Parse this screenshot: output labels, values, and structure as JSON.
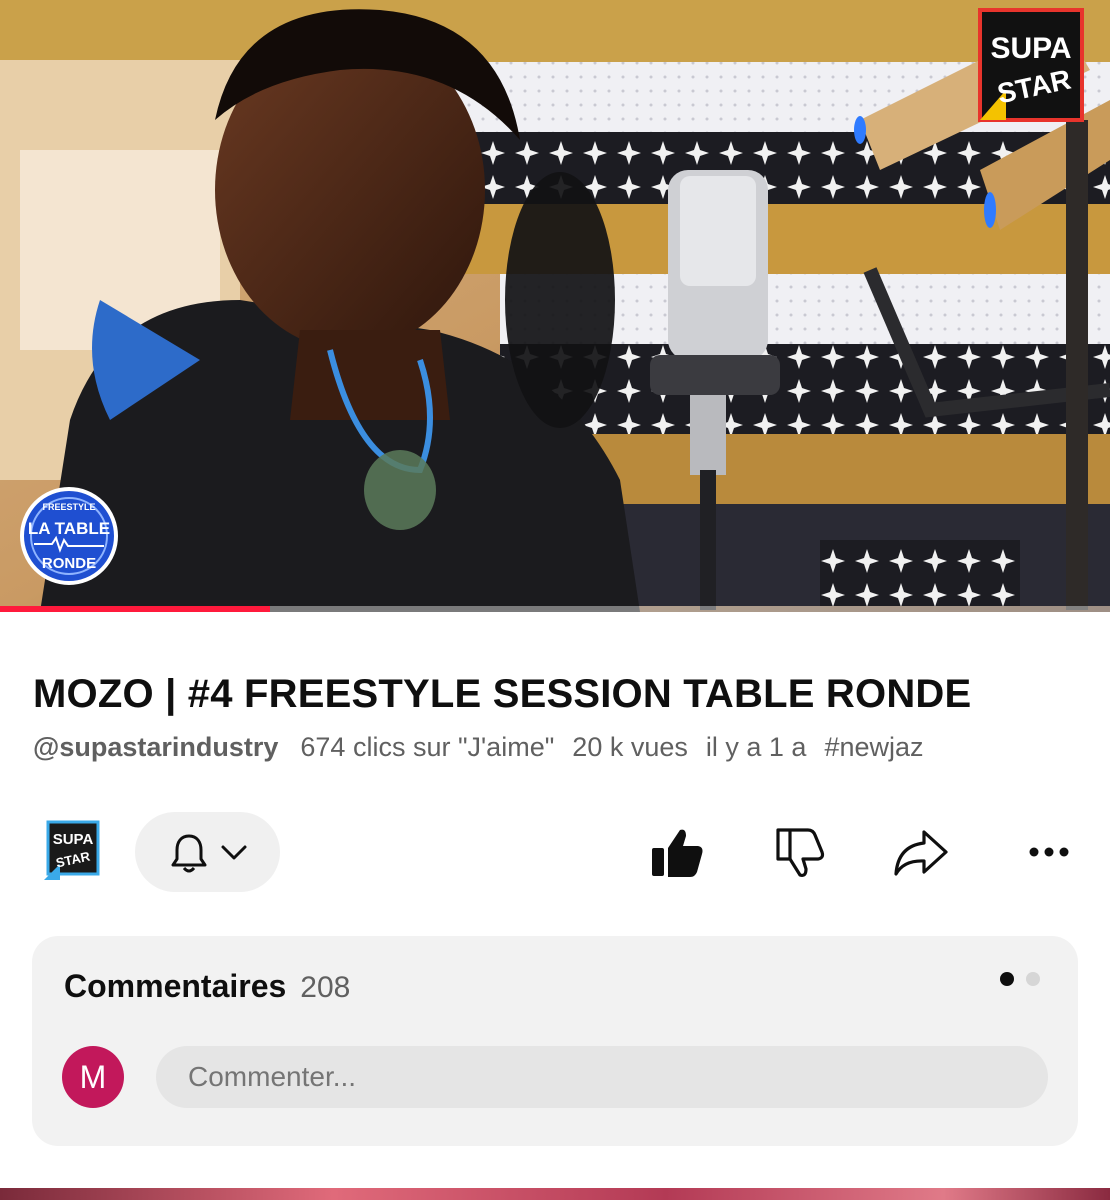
{
  "video": {
    "progress_fraction": 0.243,
    "corner_logo_text": [
      "SUPA",
      "STAR"
    ],
    "watermark_text": [
      "FREESTYLE",
      "LA TABLE",
      "RONDE"
    ]
  },
  "title": "MOZO | #4 FREESTYLE SESSION TABLE RONDE",
  "meta": {
    "channel_handle": "@supastarindustry",
    "likes": "674 clics sur \"J'aime\"",
    "views": "20 k vues",
    "age": "il y a 1 a",
    "hashtag": "#newjaz"
  },
  "actions": {
    "channel_avatar_icon": "supastar-logo-icon",
    "bell_icon": "bell-icon",
    "chevron_icon": "chevron-down-icon",
    "like_icon": "thumbs-up-filled-icon",
    "dislike_icon": "thumbs-down-icon",
    "share_icon": "share-arrow-icon",
    "more_icon": "more-horizontal-icon"
  },
  "comments": {
    "label": "Commentaires",
    "count": "208",
    "user_initial": "M",
    "input_placeholder": "Commenter...",
    "pager_current": 1,
    "pager_total": 2
  },
  "colors": {
    "progress": "#ff1a3c",
    "avatar_bg": "#c2185b",
    "text_primary": "#0f0f0f",
    "text_secondary": "#606060"
  }
}
